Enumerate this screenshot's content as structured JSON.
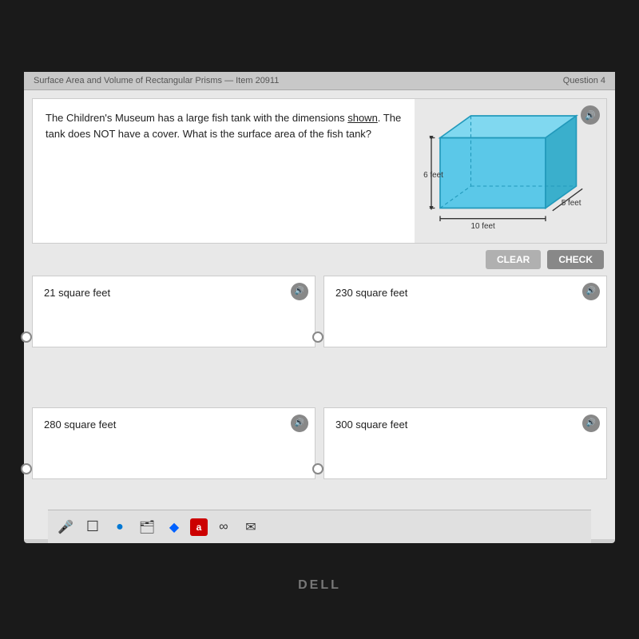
{
  "header": {
    "left_label": "Surface Area and Volume of Rectangular Prisms — Item 20911",
    "right_label": "Question 4"
  },
  "question": {
    "text_part1": "The Children's Museum has a large fish tank with the dimensions ",
    "text_underline": "shown",
    "text_part2": ". The tank does NOT have a cover. What is the surface area of the fish tank?",
    "audio_label": "🔊"
  },
  "diagram": {
    "label_height": "6 feet",
    "label_width": "10 feet",
    "label_depth": "5 feet"
  },
  "controls": {
    "clear_label": "CLEAR",
    "check_label": "CheCK"
  },
  "answers": [
    {
      "id": "a",
      "text": "21 square feet"
    },
    {
      "id": "b",
      "text": "230 square feet"
    },
    {
      "id": "c",
      "text": "280 square feet"
    },
    {
      "id": "d",
      "text": "300 square feet"
    }
  ],
  "taskbar": {
    "icons": [
      "🔇",
      "☐",
      "🌀",
      "🗃",
      "💎",
      "a",
      "∞",
      "✉"
    ]
  },
  "brand": "DELL"
}
